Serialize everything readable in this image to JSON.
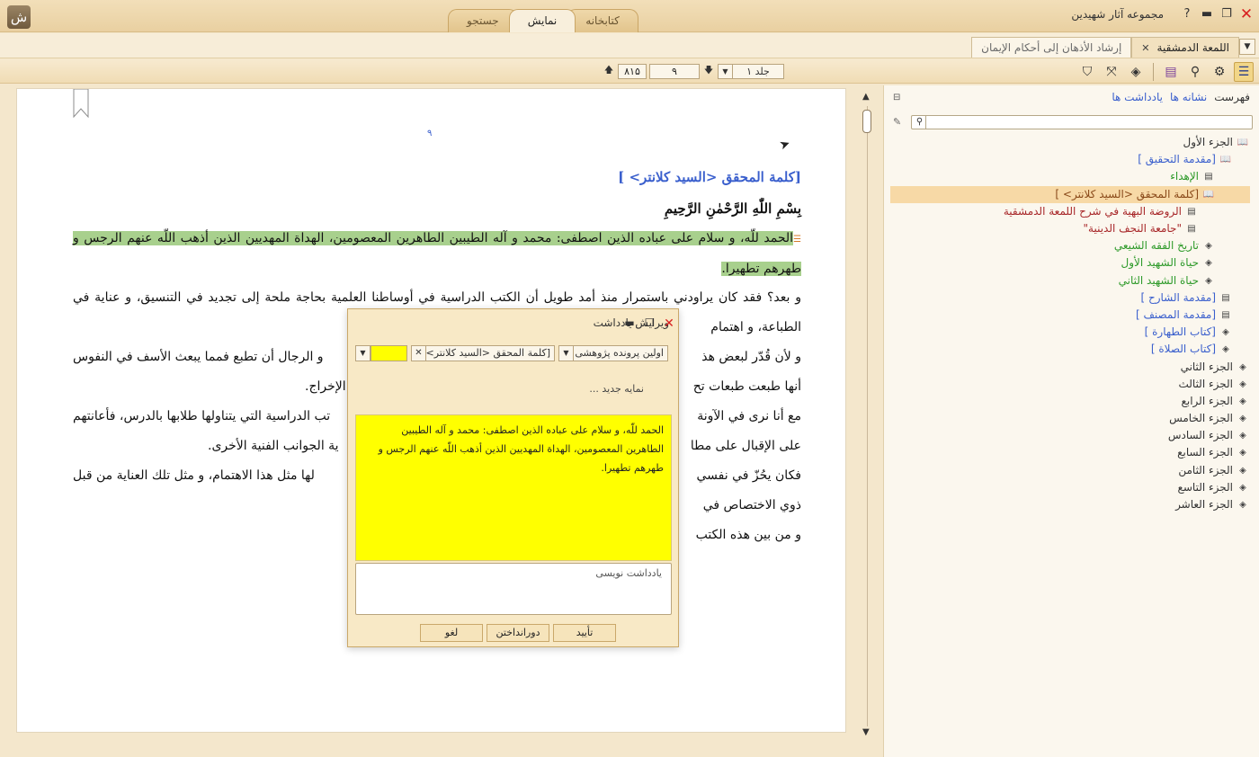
{
  "app": {
    "title": "مجموعه آثار شهیدین",
    "logo_glyph": "ﺵ"
  },
  "main_tabs": [
    {
      "label": "جستجو",
      "active": false
    },
    {
      "label": "نمایش",
      "active": true
    },
    {
      "label": "کتابخانه",
      "active": false
    }
  ],
  "doc_tabs": [
    {
      "label": "اللمعة الدمشقية",
      "active": true
    },
    {
      "label": "إرشاد الأذهان إلى أحكام الإيمان",
      "active": false
    }
  ],
  "toolbar": {
    "total_pages": "۸۱۵",
    "current_page": "۹",
    "volume": "جلد ۱"
  },
  "reader": {
    "page_number": "۹",
    "section_title": "[كلمة المحقق <السيد كلانتر> ]",
    "basmala": "بِسْمِ اللّٰهِ الرَّحْمٰنِ الرَّحِيمِ",
    "highlighted_text": "الحمد للّه، و سلام على عباده الذين اصطفى: محمد و آله الطيبين الطاهرين المعصومين، الهداة المهديين الذين أذهب اللّه عنهم الرجس و طهرهم تطهيرا.",
    "paragraphs": [
      "و بعد؟ فقد كان يراودني باستمرار منذ أمد طويل أن الكتب الدراسية في أوساطنا العلمية بحاجة ملحة إلى تجديد في التنسيق، و عناية في الطباعة، و اهتمام",
      "و لأن قُدّر لبعض هذ",
      "و الرجال أن تطبع فمما يبعث الأسف في النفوس",
      "أنها طبعت طبعات تح",
      "الإخراج.",
      "مع أنا نرى في الآونة",
      "تب الدراسية التي يتناولها طلابها بالدرس، فأعانتهم",
      "على الإقبال على مطا",
      "ية الجوانب الفنية الأخرى.",
      "فكان يحُزّ في نفسي",
      "لها مثل هذا الاهتمام، و مثل تلك العناية من قبل",
      "ذوي الاختصاص في",
      "و من بين هذه الكتب"
    ]
  },
  "side": {
    "tabs": [
      {
        "label": "فهرست",
        "active": true
      },
      {
        "label": "نشانه ها",
        "active": false
      },
      {
        "label": "يادداشت ها",
        "active": false
      }
    ],
    "search_placeholder": "",
    "tree": [
      {
        "label": "الجزء الأول",
        "icon": "open-book",
        "indent": 0,
        "color": "c-dark",
        "selected": false
      },
      {
        "label": "[مقدمة التحقيق ]",
        "icon": "open-book",
        "indent": 1,
        "color": "c-blue",
        "selected": false
      },
      {
        "label": "الإهداء",
        "icon": "page",
        "indent": 2,
        "color": "c-green",
        "selected": false
      },
      {
        "label": "[كلمة المحقق <السيد كلانتر> ]",
        "icon": "open-book",
        "indent": 2,
        "color": "c-brown",
        "selected": true
      },
      {
        "label": "الروضة البهية في شرح اللمعة الدمشقية",
        "icon": "page",
        "indent": 3,
        "color": "c-red",
        "selected": false
      },
      {
        "label": "\"جامعة النجف الدينية\"",
        "icon": "page",
        "indent": 3,
        "color": "c-red",
        "selected": false
      },
      {
        "label": "تاريخ الفقه الشيعي",
        "icon": "closed-book",
        "indent": 2,
        "color": "c-green",
        "selected": false
      },
      {
        "label": "حياة الشهيد الأول",
        "icon": "closed-book",
        "indent": 2,
        "color": "c-green",
        "selected": false
      },
      {
        "label": "حياة الشهيد الثاني",
        "icon": "closed-book",
        "indent": 2,
        "color": "c-green",
        "selected": false
      },
      {
        "label": "[مقدمة الشارح ]",
        "icon": "page",
        "indent": 1,
        "color": "c-blue",
        "selected": false
      },
      {
        "label": "[مقدمة المصنف ]",
        "icon": "page",
        "indent": 1,
        "color": "c-blue",
        "selected": false
      },
      {
        "label": "[كتاب الطهارة ]",
        "icon": "closed-book",
        "indent": 1,
        "color": "c-blue",
        "selected": false
      },
      {
        "label": "[كتاب الصلاة ]",
        "icon": "closed-book",
        "indent": 1,
        "color": "c-blue",
        "selected": false
      },
      {
        "label": "الجزء الثاني",
        "icon": "closed-book",
        "indent": 0,
        "color": "c-dark",
        "selected": false
      },
      {
        "label": "الجزء الثالث",
        "icon": "closed-book",
        "indent": 0,
        "color": "c-dark",
        "selected": false
      },
      {
        "label": "الجزء الرابع",
        "icon": "closed-book",
        "indent": 0,
        "color": "c-dark",
        "selected": false
      },
      {
        "label": "الجزء الخامس",
        "icon": "closed-book",
        "indent": 0,
        "color": "c-dark",
        "selected": false
      },
      {
        "label": "الجزء السادس",
        "icon": "closed-book",
        "indent": 0,
        "color": "c-dark",
        "selected": false
      },
      {
        "label": "الجزء السابع",
        "icon": "closed-book",
        "indent": 0,
        "color": "c-dark",
        "selected": false
      },
      {
        "label": "الجزء الثامن",
        "icon": "closed-book",
        "indent": 0,
        "color": "c-dark",
        "selected": false
      },
      {
        "label": "الجزء التاسع",
        "icon": "closed-book",
        "indent": 0,
        "color": "c-dark",
        "selected": false
      },
      {
        "label": "الجزء العاشر",
        "icon": "closed-book",
        "indent": 0,
        "color": "c-dark",
        "selected": false
      }
    ]
  },
  "dialog": {
    "title": "ويرايش يادداشت",
    "project_select": "اولين پرونده پژوهشی",
    "section_select": "[كلمة المحقق <السيد كلانتر> ]",
    "highlight_color": "#ffff00",
    "new_note_label": "نمايه جديد ...",
    "quote_text": "الحمد للّه، و سلام على عباده الذين اصطفى: محمد و آله الطيبين الطاهرين المعصومين، الهداة المهديين الذين أذهب اللّه عنهم الرجس و طهرهم تطهيرا.",
    "note_placeholder": "يادداشت نويسی",
    "btn_confirm": "تأييد",
    "btn_discard": "دورانداختن",
    "btn_cancel": "لغو"
  },
  "colors": {
    "accent_blue": "#3a5fcd",
    "highlight_green": "#a8d08d",
    "note_yellow": "#ffff00"
  }
}
